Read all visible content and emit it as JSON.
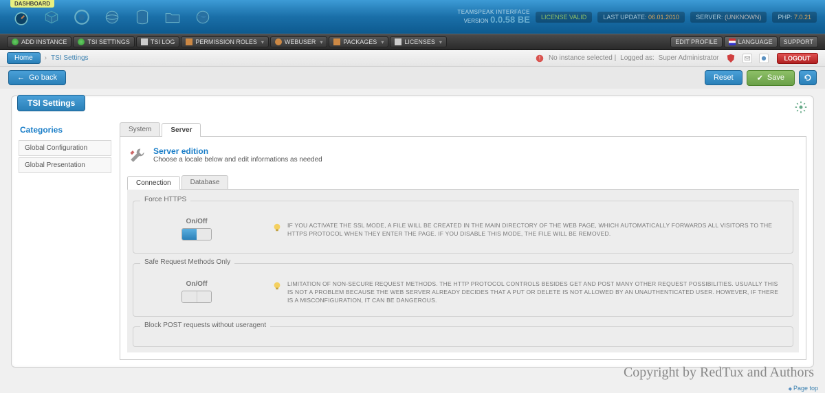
{
  "header": {
    "dashboard_tag": "DASHBOARD",
    "app_label": "TEAMSPEAK INTERFACE",
    "version_label": "VERSION",
    "version": "0.0.58 BE",
    "license": "LICENSE VALID",
    "last_update_label": "LAST UPDATE:",
    "last_update_value": "06.01.2010",
    "server_label": "SERVER:",
    "server_value": "(UNKNOWN)",
    "php_label": "PHP:",
    "php_value": "7.0.21"
  },
  "menu": {
    "add_instance": "ADD INSTANCE",
    "tsi_settings": "TSI SETTINGS",
    "tsi_log": "TSI LOG",
    "permission_roles": "PERMISSION ROLES",
    "webuser": "WEBUSER",
    "packages": "PACKAGES",
    "licenses": "LICENSES",
    "edit_profile": "EDIT PROFILE",
    "language": "LANGUAGE",
    "support": "SUPPORT"
  },
  "crumb": {
    "home": "Home",
    "current": "TSI Settings",
    "no_instance": "No instance selected |",
    "logged_as": "Logged as:",
    "user_role": "Super Administrator",
    "logout": "LOGOUT"
  },
  "toolbar": {
    "go_back": "Go back",
    "reset": "Reset",
    "save": "Save"
  },
  "panel": {
    "title": "TSI Settings",
    "categories_title": "Categories",
    "sidebar": [
      "Global Configuration",
      "Global Presentation"
    ],
    "tabs": [
      "System",
      "Server"
    ],
    "section_title": "Server edition",
    "section_desc": "Choose a locale below and edit informations as needed",
    "subtabs": [
      "Connection",
      "Database"
    ]
  },
  "fields": {
    "onoff_label": "On/Off",
    "force_https": {
      "legend": "Force HTTPS",
      "hint": "IF YOU ACTIVATE THE SSL MODE, A FILE WILL BE CREATED IN THE MAIN DIRECTORY OF THE WEB PAGE, WHICH AUTOMATICALLY FORWARDS ALL VISITORS TO THE HTTPS PROTOCOL WHEN THEY ENTER THE PAGE. IF YOU DISABLE THIS MODE, THE FILE WILL BE REMOVED."
    },
    "safe_request": {
      "legend": "Safe Request Methods Only",
      "hint": "LIMITATION OF NON-SECURE REQUEST METHODS. THE HTTP PROTOCOL CONTROLS BESIDES GET AND POST MANY OTHER REQUEST POSSIBILITIES. USUALLY THIS IS NOT A PROBLEM BECAUSE THE WEB SERVER ALREADY DECIDES THAT A PUT OR DELETE IS NOT ALLOWED BY AN UNAUTHENTICATED USER. HOWEVER, IF THERE IS A MISCONFIGURATION, IT CAN BE DANGEROUS."
    },
    "block_post": {
      "legend": "Block POST requests without useragent"
    }
  },
  "footer": {
    "copyright": "Copyright by RedTux and Authors",
    "pagetop": "Page top"
  }
}
